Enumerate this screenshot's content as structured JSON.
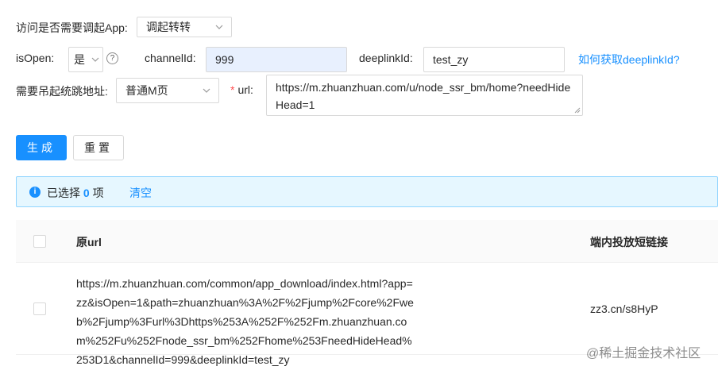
{
  "form": {
    "open_app_label": "访问是否需要调起App",
    "open_app_value": "调起转转",
    "isopen_label": "isOpen",
    "isopen_value": "是",
    "channel_label": "channelId",
    "channel_value": "999",
    "deeplink_label": "deeplinkId",
    "deeplink_value": "test_zy",
    "deeplink_help_link": "如何获取deeplinkId?",
    "jump_label": "需要吊起统跳地址",
    "jump_value": "普通M页",
    "url_required_mark": "*",
    "url_label": "url",
    "url_value": "https://m.zhuanzhuan.com/u/node_ssr_bm/home?needHideHead=1",
    "colon": ":",
    "help_icon": "?"
  },
  "buttons": {
    "generate": "生成",
    "reset": "重置"
  },
  "alert": {
    "prefix": "已选择",
    "count": "0",
    "suffix": "项",
    "clear": "清空",
    "icon_symbol": "i"
  },
  "table": {
    "columns": [
      "原url",
      "端内投放短链接"
    ],
    "rows": [
      {
        "original_url": "https://m.zhuanzhuan.com/common/app_download/index.html?app=zz&isOpen=1&path=zhuanzhuan%3A%2F%2Fjump%2Fcore%2Fweb%2Fjump%3Furl%3Dhttps%253A%252F%252Fm.zhuanzhuan.com%252Fu%252Fnode_ssr_bm%252Fhome%253FneedHideHead%253D1&channelId=999&deeplinkId=test_zy",
        "short_link": "zz3.cn/s8HyP"
      }
    ]
  },
  "watermark": "@稀土掘金技术社区",
  "colors": {
    "primary": "#1890ff",
    "alert_bg": "#e6f7ff",
    "alert_border": "#91d5ff",
    "filled_input": "#e8f0fe",
    "required": "#ff4d4f"
  }
}
